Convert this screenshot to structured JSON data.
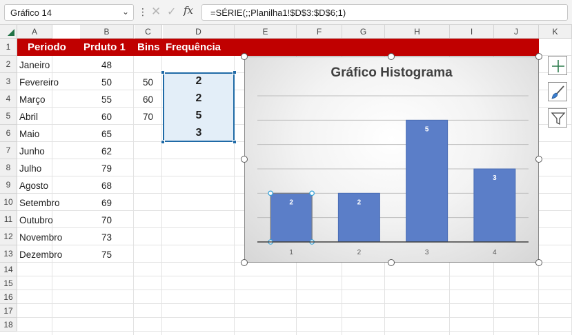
{
  "formula_bar": {
    "name_box": "Gráfico 14",
    "formula": "=SÉRIE(;;Planilha1!$D$3:$D$6;1)",
    "fx_label": "fx"
  },
  "sheet": {
    "columns": [
      "A",
      "B",
      "C",
      "D",
      "E",
      "F",
      "G",
      "H",
      "I",
      "J",
      "K"
    ],
    "rows": [
      "1",
      "2",
      "3",
      "4",
      "5",
      "6",
      "7",
      "8",
      "9",
      "10",
      "11",
      "12",
      "13",
      "14",
      "15",
      "16",
      "17",
      "18"
    ],
    "headers": {
      "periodo": "Periodo",
      "produto": "Prduto 1",
      "bins": "Bins",
      "frequencia": "Frequência"
    },
    "data": [
      {
        "month": "Janeiro",
        "value": "48"
      },
      {
        "month": "Fevereiro",
        "value": "50"
      },
      {
        "month": "Março",
        "value": "55"
      },
      {
        "month": "Abril",
        "value": "60"
      },
      {
        "month": "Maio",
        "value": "65"
      },
      {
        "month": "Junho",
        "value": "62"
      },
      {
        "month": "Julho",
        "value": "79"
      },
      {
        "month": "Agosto",
        "value": "68"
      },
      {
        "month": "Setembro",
        "value": "69"
      },
      {
        "month": "Outubro",
        "value": "70"
      },
      {
        "month": "Novembro",
        "value": "73"
      },
      {
        "month": "Dezembro",
        "value": "75"
      }
    ],
    "bins": [
      "50",
      "60",
      "70"
    ],
    "frequencies": [
      "2",
      "2",
      "5",
      "3"
    ]
  },
  "chart_data": {
    "type": "bar",
    "title": "Gráfico Histograma",
    "categories": [
      "1",
      "2",
      "3",
      "4"
    ],
    "values": [
      2,
      2,
      5,
      3
    ],
    "data_labels": [
      "2",
      "2",
      "5",
      "3"
    ],
    "ylim": [
      0,
      6
    ],
    "grid": true,
    "legend": "none",
    "bar_color": "#5b7ec8",
    "selected_bar": 0
  },
  "chart_tools": [
    {
      "name": "chart-elements-button",
      "icon": "plus-icon"
    },
    {
      "name": "chart-styles-button",
      "icon": "brush-icon"
    },
    {
      "name": "chart-filters-button",
      "icon": "filter-icon"
    }
  ],
  "colors": {
    "header_fill": "#c00000",
    "selection": "#1f6aa6",
    "accent": "#217346"
  }
}
